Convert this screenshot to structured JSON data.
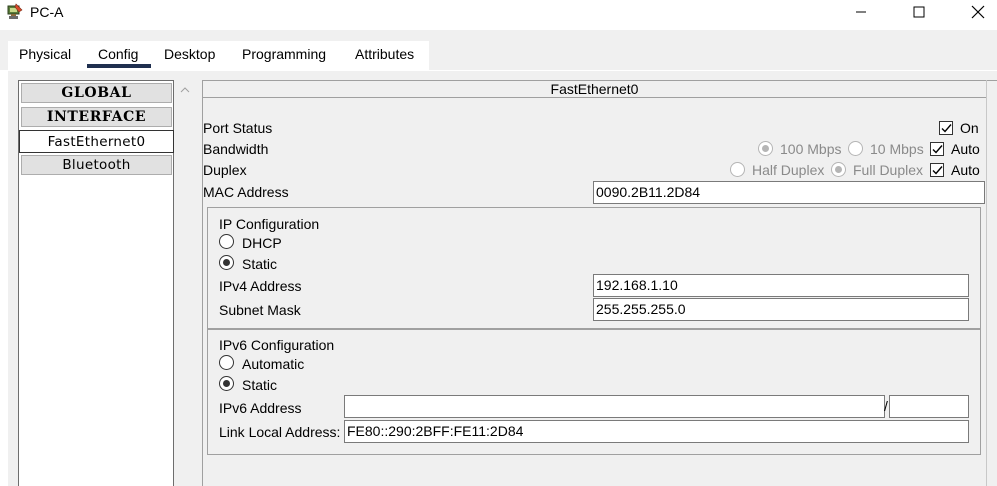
{
  "window": {
    "title": "PC-A"
  },
  "tabs": [
    {
      "label": "Physical"
    },
    {
      "label": "Config"
    },
    {
      "label": "Desktop"
    },
    {
      "label": "Programming"
    },
    {
      "label": "Attributes"
    }
  ],
  "active_tab": "Config",
  "sidebar": {
    "items": [
      {
        "label": "GLOBAL"
      },
      {
        "label": "INTERFACE"
      },
      {
        "label": "FastEthernet0"
      },
      {
        "label": "Bluetooth"
      }
    ],
    "selected": "FastEthernet0"
  },
  "panel": {
    "title": "FastEthernet0",
    "port_status": {
      "label": "Port Status",
      "on_label": "On",
      "on_checked": true
    },
    "bandwidth": {
      "label": "Bandwidth",
      "opt_100": "100 Mbps",
      "opt_10": "10 Mbps",
      "auto_label": "Auto",
      "auto_checked": true
    },
    "duplex": {
      "label": "Duplex",
      "opt_half": "Half Duplex",
      "opt_full": "Full Duplex",
      "auto_label": "Auto",
      "auto_checked": true
    },
    "mac": {
      "label": "MAC Address",
      "value": "0090.2B11.2D84"
    },
    "ipv4": {
      "heading": "IP Configuration",
      "dhcp_label": "DHCP",
      "static_label": "Static",
      "selected": "Static",
      "address_label": "IPv4 Address",
      "address_value": "192.168.1.10",
      "mask_label": "Subnet Mask",
      "mask_value": "255.255.255.0"
    },
    "ipv6": {
      "heading": "IPv6 Configuration",
      "auto_label": "Automatic",
      "static_label": "Static",
      "selected": "Static",
      "address_label": "IPv6 Address",
      "address_value": "",
      "prefix_separator": "/",
      "prefix_value": "",
      "link_local_label": "Link Local Address:",
      "link_local_value": "FE80::290:2BFF:FE11:2D84"
    }
  },
  "colors": {
    "tab_underline": "#1f2f4f",
    "background": "#f0f0f0"
  }
}
